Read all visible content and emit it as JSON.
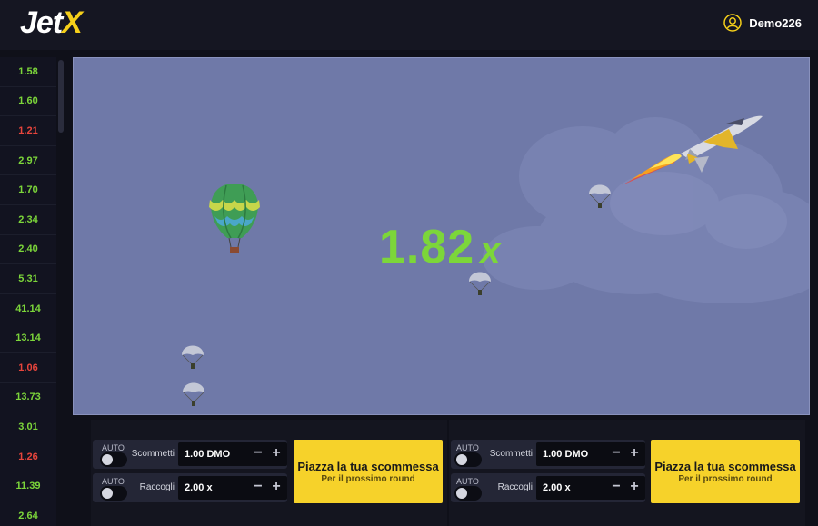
{
  "header": {
    "logo_main": "Jet",
    "logo_accent": "X",
    "username": "Demo226"
  },
  "history": [
    {
      "value": "1.58",
      "status": "win"
    },
    {
      "value": "1.60",
      "status": "win"
    },
    {
      "value": "1.21",
      "status": "loss"
    },
    {
      "value": "2.97",
      "status": "win"
    },
    {
      "value": "1.70",
      "status": "win"
    },
    {
      "value": "2.34",
      "status": "win"
    },
    {
      "value": "2.40",
      "status": "win"
    },
    {
      "value": "5.31",
      "status": "win"
    },
    {
      "value": "41.14",
      "status": "win"
    },
    {
      "value": "13.14",
      "status": "win"
    },
    {
      "value": "1.06",
      "status": "loss"
    },
    {
      "value": "13.73",
      "status": "win"
    },
    {
      "value": "3.01",
      "status": "win"
    },
    {
      "value": "1.26",
      "status": "loss"
    },
    {
      "value": "11.39",
      "status": "win"
    },
    {
      "value": "2.64",
      "status": "win"
    }
  ],
  "game": {
    "multiplier": "1.82",
    "multiplier_suffix": "x"
  },
  "bet_panels": [
    {
      "auto_label_1": "AUTO",
      "bet_label": "Scommetti",
      "bet_value": "1.00 DMO",
      "auto_label_2": "AUTO",
      "cashout_label": "Raccogli",
      "cashout_value": "2.00 x",
      "minus": "−",
      "plus": "+",
      "button_main": "Piazza la tua scommessa",
      "button_sub": "Per il prossimo round"
    },
    {
      "auto_label_1": "AUTO",
      "bet_label": "Scommetti",
      "bet_value": "1.00 DMO",
      "auto_label_2": "AUTO",
      "cashout_label": "Raccogli",
      "cashout_value": "2.00 x",
      "minus": "−",
      "plus": "+",
      "button_main": "Piazza la tua scommessa",
      "button_sub": "Per il prossimo round"
    }
  ],
  "colors": {
    "accent": "#f6d22a",
    "win": "#7cd63a",
    "loss": "#e8453c",
    "sky": "#6f79a8"
  },
  "icons": [
    "user-icon",
    "hot-air-balloon-icon",
    "parachute-icon",
    "jet-icon"
  ]
}
